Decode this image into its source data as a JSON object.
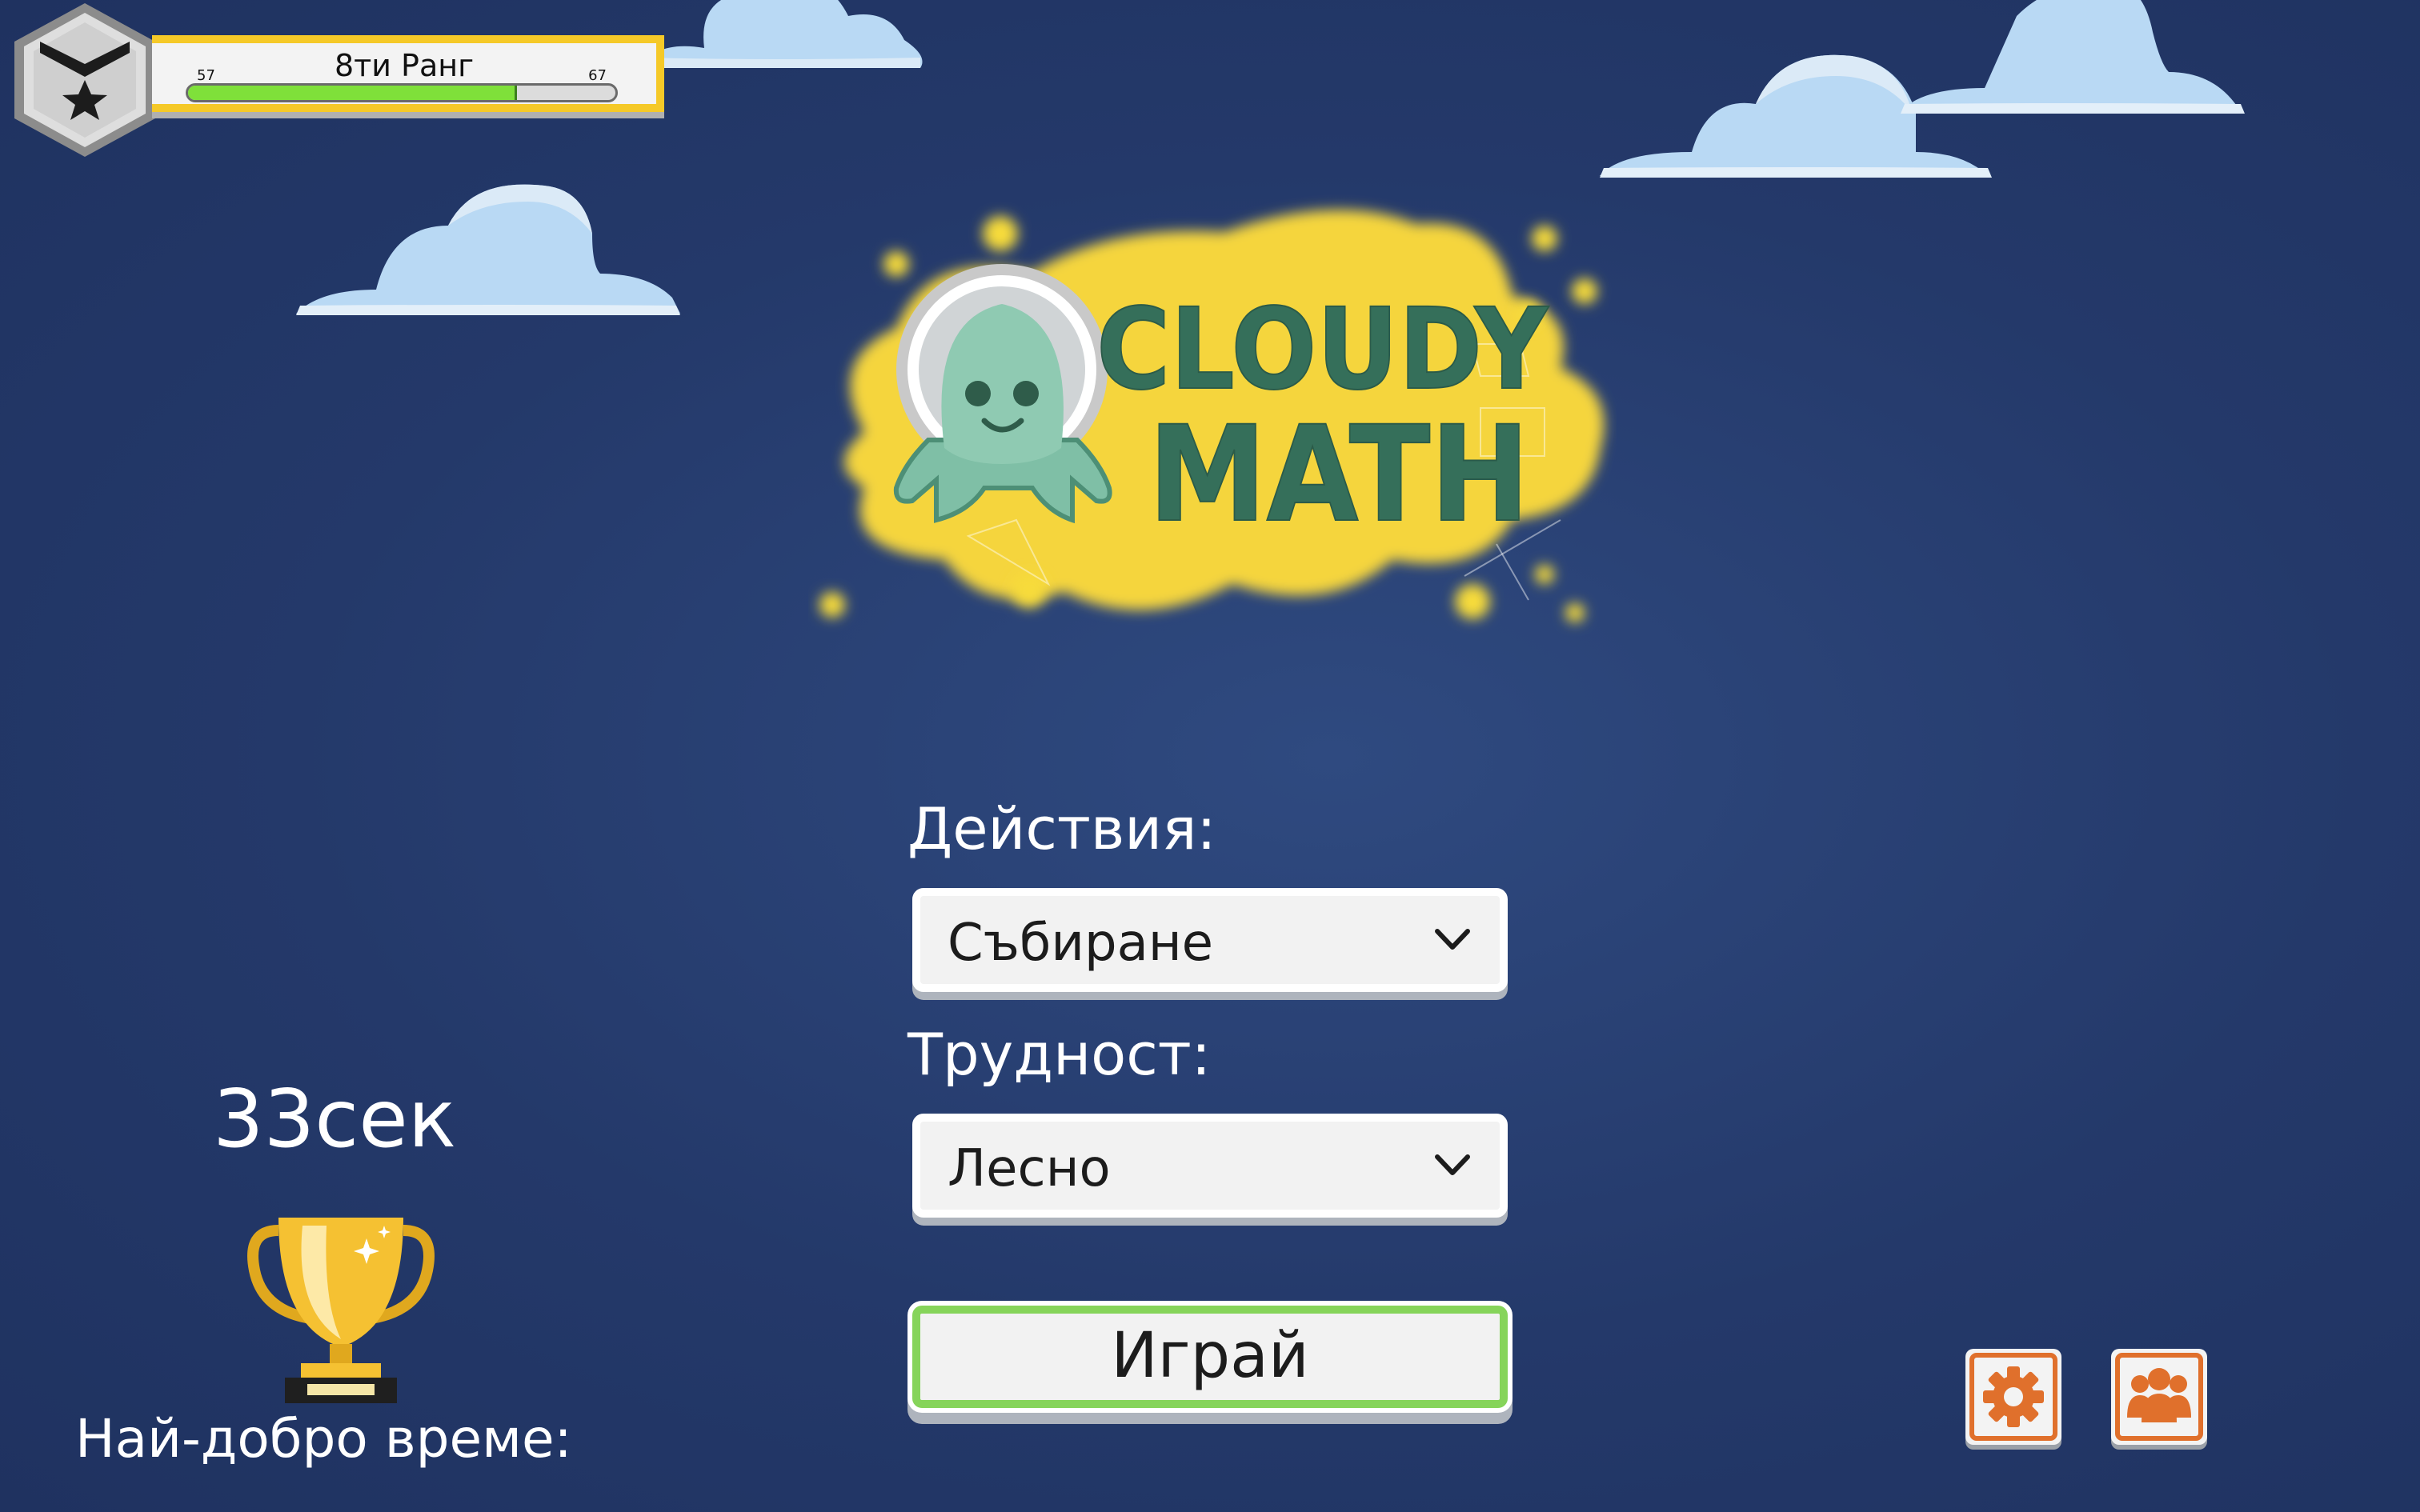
{
  "rank": {
    "title": "8ти Ранг",
    "min": "57",
    "max": "67",
    "progress": 0.77
  },
  "logo": {
    "line1": "CLOUDY",
    "line2": "MATH"
  },
  "operations": {
    "label": "Действия:",
    "value": "Събиране"
  },
  "difficulty": {
    "label": "Трудност:",
    "value": "Лесно"
  },
  "play": {
    "label": "Играй"
  },
  "best_time": {
    "value": "33сек",
    "label": "Най-добро време:"
  },
  "colors": {
    "background": "#24396a",
    "cloud": "#b9d9f4",
    "accent_yellow": "#f5d53d",
    "play_border": "#86d45a",
    "icon_orange": "#e0702c"
  },
  "icons": [
    "rank-star-icon",
    "chevron-down-icon",
    "trophy-icon",
    "gear-icon",
    "group-icon"
  ]
}
